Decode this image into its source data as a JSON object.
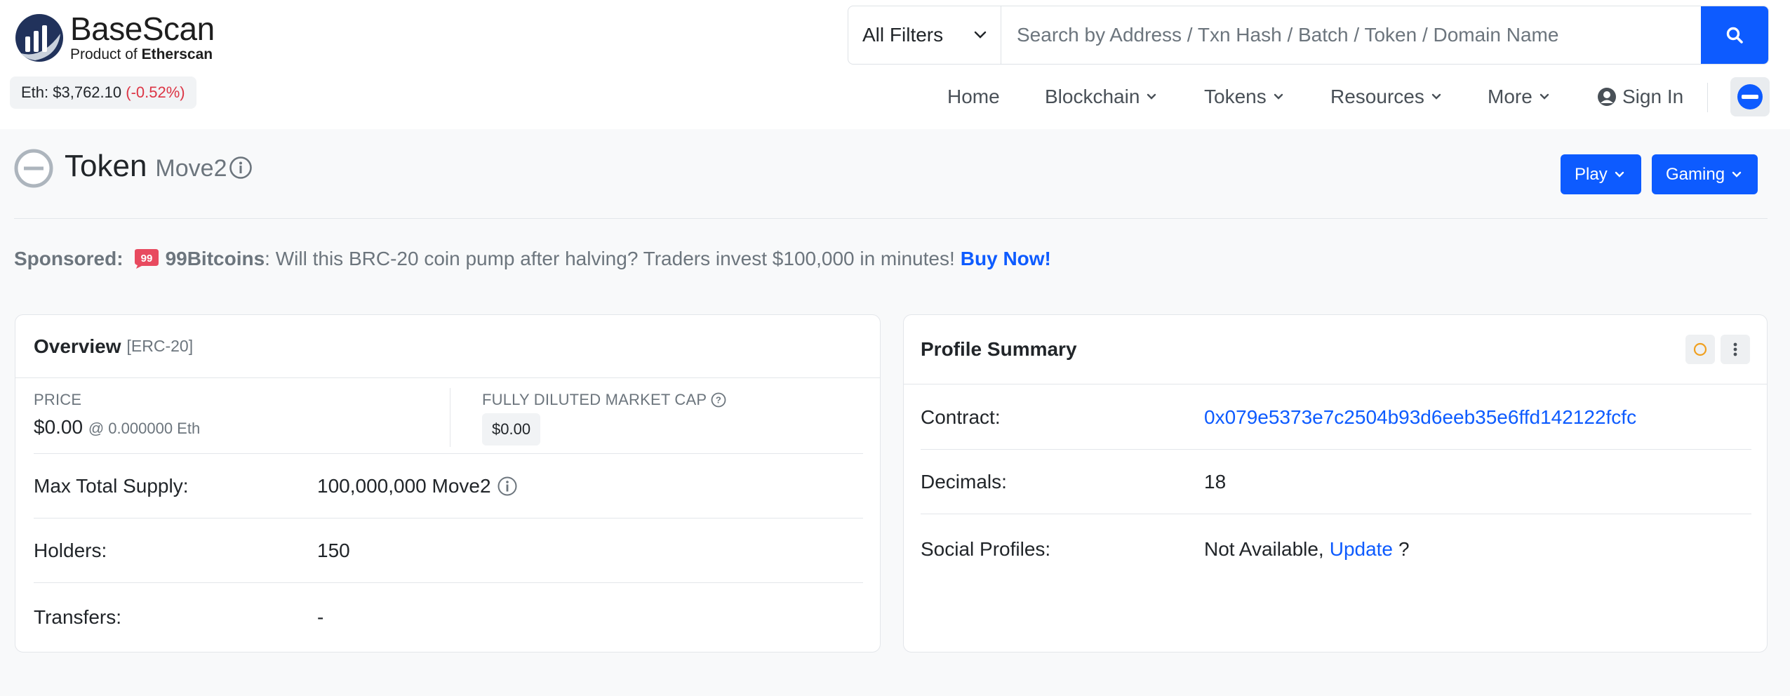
{
  "brand": {
    "name": "BaseScan",
    "product_prefix": "Product of",
    "product_name": "Etherscan"
  },
  "eth_price": {
    "label": "Eth: $3,762.10",
    "change": "(-0.52%)"
  },
  "search": {
    "filter_label": "All Filters",
    "placeholder": "Search by Address / Txn Hash / Batch / Token / Domain Name"
  },
  "nav": {
    "home": "Home",
    "blockchain": "Blockchain",
    "tokens": "Tokens",
    "resources": "Resources",
    "more": "More",
    "sign_in": "Sign In"
  },
  "page": {
    "title": "Token",
    "token_name": "Move2",
    "play_label": "Play",
    "gaming_label": "Gaming"
  },
  "sponsor": {
    "label": "Sponsored:",
    "brand": "99Bitcoins",
    "message": ": Will this BRC-20 coin pump after halving? Traders invest $100,000 in minutes!",
    "cta": "Buy Now!"
  },
  "overview": {
    "title": "Overview",
    "tag": "[ERC-20]",
    "price_label": "PRICE",
    "price_value": "$0.00",
    "price_eth": "@ 0.000000 Eth",
    "mcap_label": "FULLY DILUTED MARKET CAP",
    "mcap_value": "$0.00",
    "rows": [
      {
        "label": "Max Total Supply:",
        "value": "100,000,000 Move2"
      },
      {
        "label": "Holders:",
        "value": "150"
      },
      {
        "label": "Transfers:",
        "value": "-"
      }
    ]
  },
  "profile": {
    "title": "Profile Summary",
    "rows": [
      {
        "label": "Contract:",
        "value": "0x079e5373e7c2504b93d6eeb35e6ffd142122fcfc"
      },
      {
        "label": "Decimals:",
        "value": "18"
      },
      {
        "label": "Social Profiles:",
        "value": "Not Available,",
        "link": "Update",
        "suffix": "?"
      }
    ]
  },
  "colors": {
    "accent": "#0d5bff",
    "negative": "#dc3545",
    "muted": "#6c757d"
  }
}
